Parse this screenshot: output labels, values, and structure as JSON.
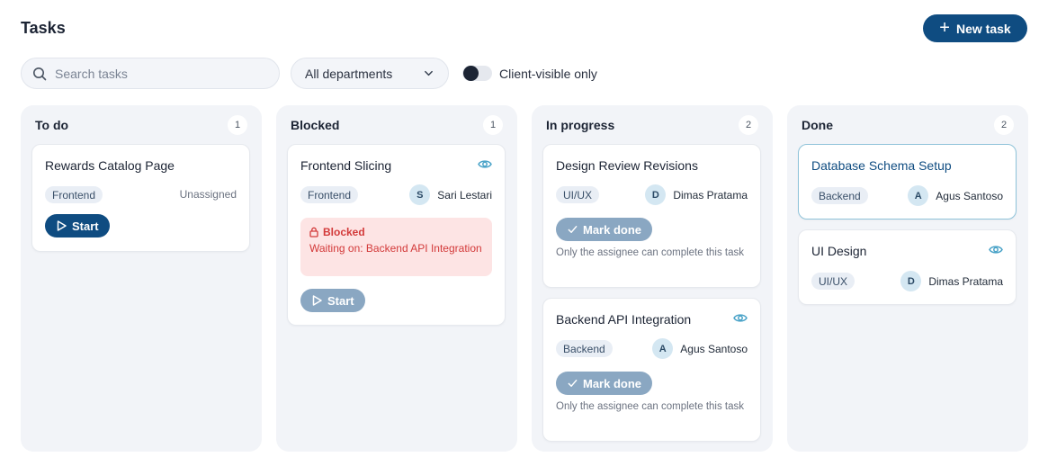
{
  "header": {
    "title": "Tasks",
    "new_task_label": "New task"
  },
  "toolbar": {
    "search_placeholder": "Search tasks",
    "department_selected": "All departments",
    "client_visible_label": "Client-visible only"
  },
  "columns": [
    {
      "title": "To do",
      "count": "1",
      "cards": [
        {
          "title": "Rewards Catalog Page",
          "tag": "Frontend",
          "assignee": "Unassigned",
          "action": "Start"
        }
      ]
    },
    {
      "title": "Blocked",
      "count": "1",
      "cards": [
        {
          "title": "Frontend Slicing",
          "tag": "Frontend",
          "avatar": "S",
          "assignee": "Sari Lestari",
          "blocked_label": "Blocked",
          "blocked_message": "Waiting on: Backend API Integration",
          "action": "Start"
        }
      ]
    },
    {
      "title": "In progress",
      "count": "2",
      "cards": [
        {
          "title": "Design Review Revisions",
          "tag": "UI/UX",
          "avatar": "D",
          "assignee": "Dimas Pratama",
          "action": "Mark done",
          "note": "Only the assignee can complete this task"
        },
        {
          "title": "Backend API Integration",
          "tag": "Backend",
          "avatar": "A",
          "assignee": "Agus Santoso",
          "action": "Mark done",
          "note": "Only the assignee can complete this task"
        }
      ]
    },
    {
      "title": "Done",
      "count": "2",
      "cards": [
        {
          "title": "Database Schema Setup",
          "tag": "Backend",
          "avatar": "A",
          "assignee": "Agus Santoso"
        },
        {
          "title": "UI Design",
          "tag": "UI/UX",
          "avatar": "D",
          "assignee": "Dimas Pratama"
        }
      ]
    }
  ],
  "colors": {
    "primary": "#0f4c81",
    "primary_disabled": "#8aa7c2",
    "blocked": "#d33a3a",
    "blocked_bg": "#fde4e4",
    "highlight_border": "#8fc3d9",
    "eye": "#4aa3c8"
  },
  "icons": {
    "search": "search-icon",
    "plus": "plus-icon",
    "chevron": "chevron-down-icon",
    "eye": "eye-icon",
    "play": "play-icon",
    "check": "check-icon",
    "lock": "lock-icon"
  }
}
